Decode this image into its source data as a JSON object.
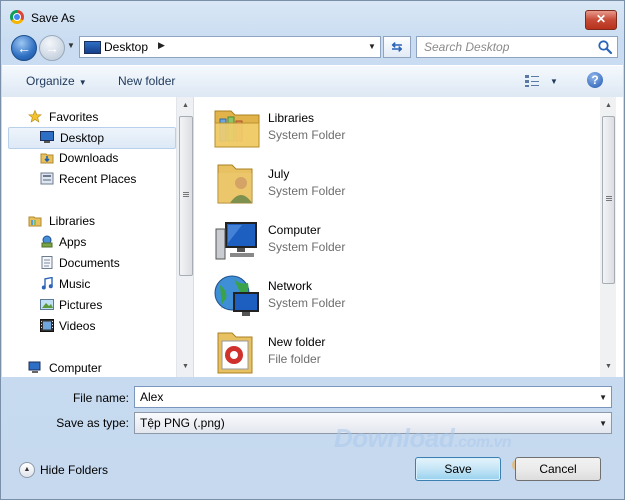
{
  "window": {
    "title": "Save As",
    "close_glyph": "✕"
  },
  "address_bar": {
    "location": "Desktop",
    "breadcrumb_separator_icon": "chevron-right-icon",
    "dropdown_icon": "chevron-down-icon"
  },
  "search": {
    "placeholder": "Search Desktop",
    "icon": "search-icon"
  },
  "toolbar": {
    "organize_label": "Organize",
    "new_folder_label": "New folder",
    "help_glyph": "?"
  },
  "nav_pane": {
    "items": [
      {
        "label": "Favorites",
        "icon": "star-icon",
        "level": 0
      },
      {
        "label": "Desktop",
        "icon": "desktop-icon",
        "level": 1,
        "selected": true
      },
      {
        "label": "Downloads",
        "icon": "downloads-icon",
        "level": 1
      },
      {
        "label": "Recent Places",
        "icon": "recent-places-icon",
        "level": 1
      },
      {
        "label": "Libraries",
        "icon": "libraries-icon",
        "level": 0
      },
      {
        "label": "Apps",
        "icon": "apps-icon",
        "level": 1
      },
      {
        "label": "Documents",
        "icon": "documents-icon",
        "level": 1
      },
      {
        "label": "Music",
        "icon": "music-icon",
        "level": 1
      },
      {
        "label": "Pictures",
        "icon": "pictures-icon",
        "level": 1
      },
      {
        "label": "Videos",
        "icon": "videos-icon",
        "level": 1
      },
      {
        "label": "Computer",
        "icon": "computer-icon",
        "level": 0
      }
    ]
  },
  "content": {
    "items": [
      {
        "name": "Libraries",
        "type": "System Folder",
        "icon": "libraries-folder-icon"
      },
      {
        "name": "July",
        "type": "System Folder",
        "icon": "user-folder-icon"
      },
      {
        "name": "Computer",
        "type": "System Folder",
        "icon": "computer-icon"
      },
      {
        "name": "Network",
        "type": "System Folder",
        "icon": "network-icon"
      },
      {
        "name": "New folder",
        "type": "File folder",
        "icon": "folder-icon"
      }
    ]
  },
  "form": {
    "file_name_label": "File name:",
    "file_name_value": "Alex",
    "save_type_label": "Save as type:",
    "save_type_value": "Tệp PNG (.png)"
  },
  "footer": {
    "hide_folders_label": "Hide Folders",
    "save_label": "Save",
    "cancel_label": "Cancel"
  },
  "watermark": {
    "text": "Download",
    "suffix": ".com.vn"
  },
  "colors": {
    "selection": "#dde9f6",
    "accent": "#2a63b8"
  }
}
